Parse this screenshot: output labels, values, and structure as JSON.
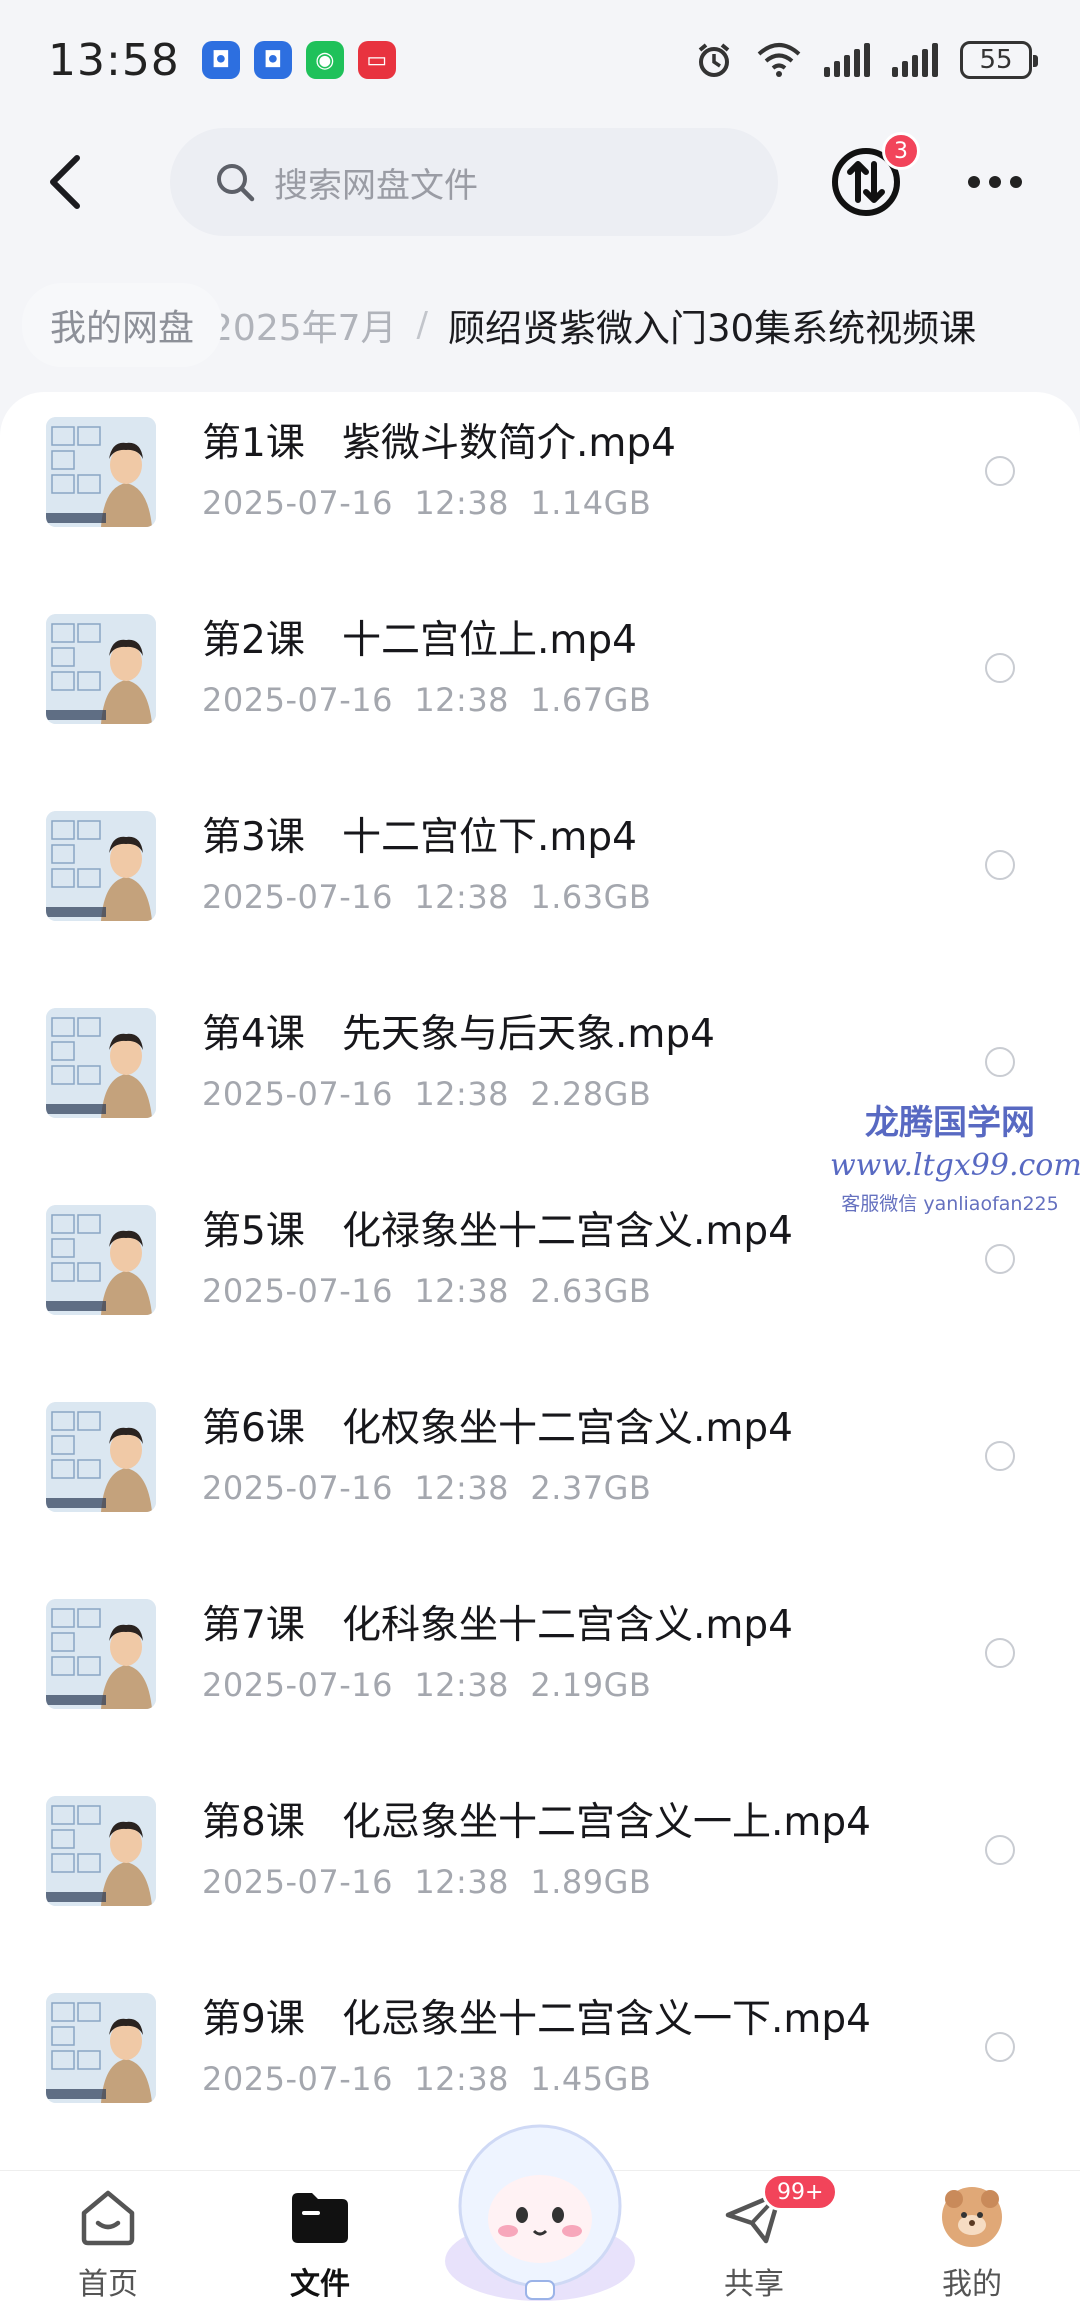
{
  "status_bar": {
    "time": "13:58",
    "battery": "55",
    "notification_icons": [
      "app-notification-icon",
      "app-notification-icon",
      "wechat-icon",
      "message-icon"
    ],
    "status_icons": [
      "alarm-icon",
      "wifi-icon",
      "signal-icon",
      "signal-icon",
      "battery-icon"
    ]
  },
  "header": {
    "search_placeholder": "搜索网盘文件",
    "transfer_badge": "3"
  },
  "breadcrumb": {
    "root": "我的网盘",
    "middle": "2025年7月",
    "separator": "/",
    "current": "顾绍贤紫微入门30集系统视频课"
  },
  "files": [
    {
      "name": "第1课   紫微斗数简介.mp4",
      "date": "2025-07-16",
      "time": "12:38",
      "size": "1.14GB"
    },
    {
      "name": "第2课   十二宫位上.mp4",
      "date": "2025-07-16",
      "time": "12:38",
      "size": "1.67GB"
    },
    {
      "name": "第3课   十二宫位下.mp4",
      "date": "2025-07-16",
      "time": "12:38",
      "size": "1.63GB"
    },
    {
      "name": "第4课   先天象与后天象.mp4",
      "date": "2025-07-16",
      "time": "12:38",
      "size": "2.28GB"
    },
    {
      "name": "第5课   化禄象坐十二宫含义.mp4",
      "date": "2025-07-16",
      "time": "12:38",
      "size": "2.63GB"
    },
    {
      "name": "第6课   化权象坐十二宫含义.mp4",
      "date": "2025-07-16",
      "time": "12:38",
      "size": "2.37GB"
    },
    {
      "name": "第7课   化科象坐十二宫含义.mp4",
      "date": "2025-07-16",
      "time": "12:38",
      "size": "2.19GB"
    },
    {
      "name": "第8课   化忌象坐十二宫含义一上.mp4",
      "date": "2025-07-16",
      "time": "12:38",
      "size": "1.89GB"
    },
    {
      "name": "第9课   化忌象坐十二宫含义一下.mp4",
      "date": "2025-07-16",
      "time": "12:38",
      "size": "1.45GB"
    }
  ],
  "watermark": {
    "title": "龙腾国学网",
    "url": "www.ltgx99.com",
    "contact": "客服微信 yanliaofan225"
  },
  "bottom_nav": {
    "home": "首页",
    "files": "文件",
    "share": "共享",
    "share_badge": "99+",
    "mine": "我的"
  },
  "colors": {
    "badge_red": "#f2445a",
    "watermark_blue": "#3b50b8",
    "background": "#f4f5f8"
  }
}
